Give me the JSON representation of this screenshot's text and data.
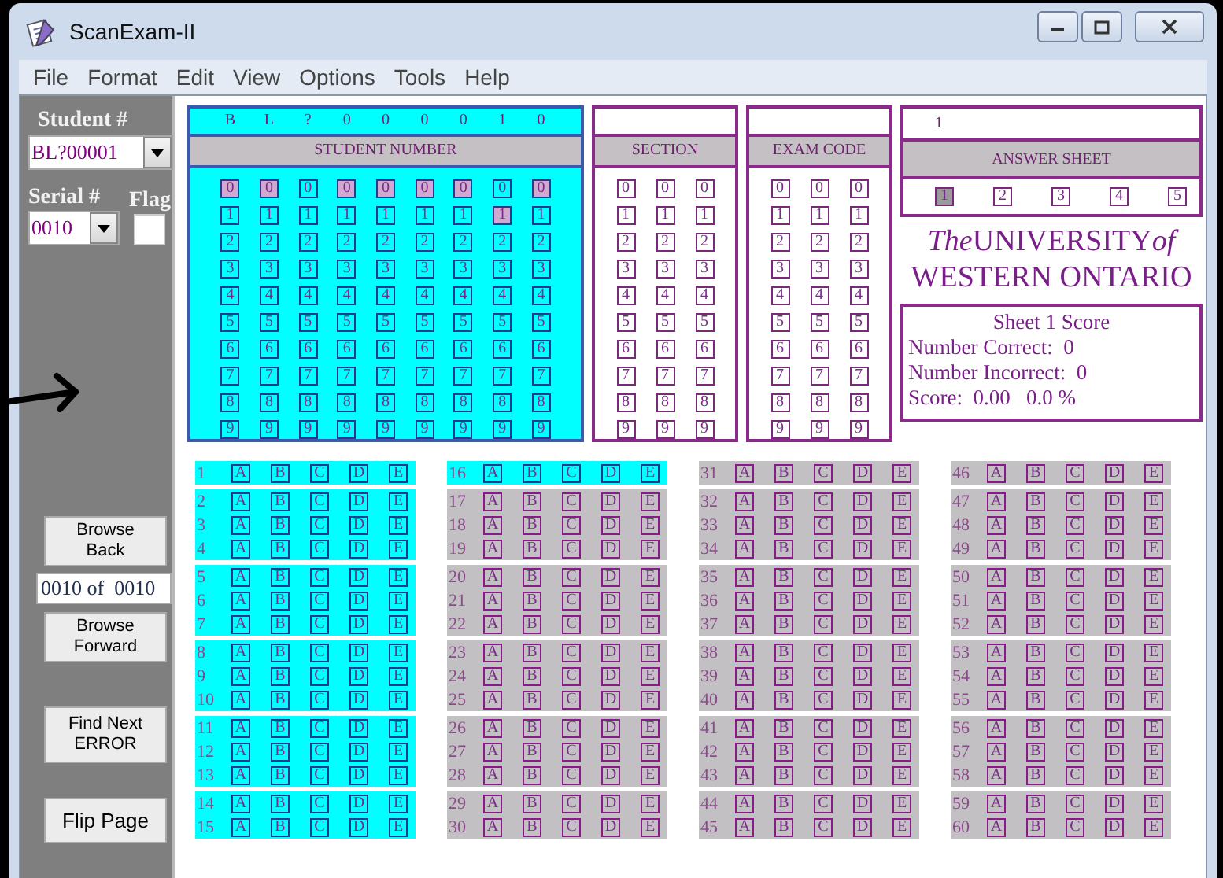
{
  "window": {
    "title": "ScanExam-II"
  },
  "menu": [
    "File",
    "Format",
    "Edit",
    "View",
    "Options",
    "Tools",
    "Help"
  ],
  "sidebar": {
    "student_label": "Student #",
    "student_value": "BL?00001",
    "serial_label": "Serial #",
    "serial_value": "0010",
    "flag_label": "Flag",
    "browse_back": "Browse\nBack",
    "position": "0010 of  0010",
    "browse_forward": "Browse\nForward",
    "find_next": "Find Next\nERROR",
    "flip_page": "Flip Page"
  },
  "student_number": {
    "entered": [
      "B",
      "L",
      "?",
      "0",
      "0",
      "0",
      "0",
      "1",
      "0"
    ],
    "title": "STUDENT NUMBER",
    "columns": [
      {
        "bubbles": [
          {
            "label": "0",
            "selected": true
          },
          {
            "label": "1",
            "selected": false
          },
          {
            "label": "2",
            "selected": false
          },
          {
            "label": "3",
            "selected": false
          },
          {
            "label": "4",
            "selected": false
          },
          {
            "label": "5",
            "selected": false
          },
          {
            "label": "6",
            "selected": false
          },
          {
            "label": "7",
            "selected": false
          },
          {
            "label": "8",
            "selected": false
          },
          {
            "label": "9",
            "selected": false
          }
        ]
      },
      {
        "bubbles": [
          {
            "label": "0",
            "selected": true
          },
          {
            "label": "1",
            "selected": false
          },
          {
            "label": "2",
            "selected": false
          },
          {
            "label": "3",
            "selected": false
          },
          {
            "label": "4",
            "selected": false
          },
          {
            "label": "5",
            "selected": false
          },
          {
            "label": "6",
            "selected": false
          },
          {
            "label": "7",
            "selected": false
          },
          {
            "label": "8",
            "selected": false
          },
          {
            "label": "9",
            "selected": false
          }
        ]
      },
      {
        "bubbles": [
          {
            "label": "0",
            "selected": false
          },
          {
            "label": "1",
            "selected": false
          },
          {
            "label": "2",
            "selected": false
          },
          {
            "label": "3",
            "selected": false
          },
          {
            "label": "4",
            "selected": false
          },
          {
            "label": "5",
            "selected": false
          },
          {
            "label": "6",
            "selected": false
          },
          {
            "label": "7",
            "selected": false
          },
          {
            "label": "8",
            "selected": false
          },
          {
            "label": "9",
            "selected": false
          }
        ]
      },
      {
        "bubbles": [
          {
            "label": "0",
            "selected": true
          },
          {
            "label": "1",
            "selected": false
          },
          {
            "label": "2",
            "selected": false
          },
          {
            "label": "3",
            "selected": false
          },
          {
            "label": "4",
            "selected": false
          },
          {
            "label": "5",
            "selected": false
          },
          {
            "label": "6",
            "selected": false
          },
          {
            "label": "7",
            "selected": false
          },
          {
            "label": "8",
            "selected": false
          },
          {
            "label": "9",
            "selected": false
          }
        ]
      },
      {
        "bubbles": [
          {
            "label": "0",
            "selected": true
          },
          {
            "label": "1",
            "selected": false
          },
          {
            "label": "2",
            "selected": false
          },
          {
            "label": "3",
            "selected": false
          },
          {
            "label": "4",
            "selected": false
          },
          {
            "label": "5",
            "selected": false
          },
          {
            "label": "6",
            "selected": false
          },
          {
            "label": "7",
            "selected": false
          },
          {
            "label": "8",
            "selected": false
          },
          {
            "label": "9",
            "selected": false
          }
        ]
      },
      {
        "bubbles": [
          {
            "label": "0",
            "selected": true
          },
          {
            "label": "1",
            "selected": false
          },
          {
            "label": "2",
            "selected": false
          },
          {
            "label": "3",
            "selected": false
          },
          {
            "label": "4",
            "selected": false
          },
          {
            "label": "5",
            "selected": false
          },
          {
            "label": "6",
            "selected": false
          },
          {
            "label": "7",
            "selected": false
          },
          {
            "label": "8",
            "selected": false
          },
          {
            "label": "9",
            "selected": false
          }
        ]
      },
      {
        "bubbles": [
          {
            "label": "0",
            "selected": true
          },
          {
            "label": "1",
            "selected": false
          },
          {
            "label": "2",
            "selected": false
          },
          {
            "label": "3",
            "selected": false
          },
          {
            "label": "4",
            "selected": false
          },
          {
            "label": "5",
            "selected": false
          },
          {
            "label": "6",
            "selected": false
          },
          {
            "label": "7",
            "selected": false
          },
          {
            "label": "8",
            "selected": false
          },
          {
            "label": "9",
            "selected": false
          }
        ]
      },
      {
        "bubbles": [
          {
            "label": "0",
            "selected": false
          },
          {
            "label": "1",
            "selected": true
          },
          {
            "label": "2",
            "selected": false
          },
          {
            "label": "3",
            "selected": false
          },
          {
            "label": "4",
            "selected": false
          },
          {
            "label": "5",
            "selected": false
          },
          {
            "label": "6",
            "selected": false
          },
          {
            "label": "7",
            "selected": false
          },
          {
            "label": "8",
            "selected": false
          },
          {
            "label": "9",
            "selected": false
          }
        ]
      },
      {
        "bubbles": [
          {
            "label": "0",
            "selected": true
          },
          {
            "label": "1",
            "selected": false
          },
          {
            "label": "2",
            "selected": false
          },
          {
            "label": "3",
            "selected": false
          },
          {
            "label": "4",
            "selected": false
          },
          {
            "label": "5",
            "selected": false
          },
          {
            "label": "6",
            "selected": false
          },
          {
            "label": "7",
            "selected": false
          },
          {
            "label": "8",
            "selected": false
          },
          {
            "label": "9",
            "selected": false
          }
        ]
      }
    ]
  },
  "section": {
    "title": "SECTION",
    "columns": [
      {
        "bubbles": [
          {
            "label": "0",
            "selected": false
          },
          {
            "label": "1",
            "selected": false
          },
          {
            "label": "2",
            "selected": false
          },
          {
            "label": "3",
            "selected": false
          },
          {
            "label": "4",
            "selected": false
          },
          {
            "label": "5",
            "selected": false
          },
          {
            "label": "6",
            "selected": false
          },
          {
            "label": "7",
            "selected": false
          },
          {
            "label": "8",
            "selected": false
          },
          {
            "label": "9",
            "selected": false
          }
        ]
      },
      {
        "bubbles": [
          {
            "label": "0",
            "selected": false
          },
          {
            "label": "1",
            "selected": false
          },
          {
            "label": "2",
            "selected": false
          },
          {
            "label": "3",
            "selected": false
          },
          {
            "label": "4",
            "selected": false
          },
          {
            "label": "5",
            "selected": false
          },
          {
            "label": "6",
            "selected": false
          },
          {
            "label": "7",
            "selected": false
          },
          {
            "label": "8",
            "selected": false
          },
          {
            "label": "9",
            "selected": false
          }
        ]
      },
      {
        "bubbles": [
          {
            "label": "0",
            "selected": false
          },
          {
            "label": "1",
            "selected": false
          },
          {
            "label": "2",
            "selected": false
          },
          {
            "label": "3",
            "selected": false
          },
          {
            "label": "4",
            "selected": false
          },
          {
            "label": "5",
            "selected": false
          },
          {
            "label": "6",
            "selected": false
          },
          {
            "label": "7",
            "selected": false
          },
          {
            "label": "8",
            "selected": false
          },
          {
            "label": "9",
            "selected": false
          }
        ]
      }
    ]
  },
  "exam_code": {
    "title": "EXAM CODE",
    "columns": [
      {
        "bubbles": [
          {
            "label": "0",
            "selected": false
          },
          {
            "label": "1",
            "selected": false
          },
          {
            "label": "2",
            "selected": false
          },
          {
            "label": "3",
            "selected": false
          },
          {
            "label": "4",
            "selected": false
          },
          {
            "label": "5",
            "selected": false
          },
          {
            "label": "6",
            "selected": false
          },
          {
            "label": "7",
            "selected": false
          },
          {
            "label": "8",
            "selected": false
          },
          {
            "label": "9",
            "selected": false
          }
        ]
      },
      {
        "bubbles": [
          {
            "label": "0",
            "selected": false
          },
          {
            "label": "1",
            "selected": false
          },
          {
            "label": "2",
            "selected": false
          },
          {
            "label": "3",
            "selected": false
          },
          {
            "label": "4",
            "selected": false
          },
          {
            "label": "5",
            "selected": false
          },
          {
            "label": "6",
            "selected": false
          },
          {
            "label": "7",
            "selected": false
          },
          {
            "label": "8",
            "selected": false
          },
          {
            "label": "9",
            "selected": false
          }
        ]
      },
      {
        "bubbles": [
          {
            "label": "0",
            "selected": false
          },
          {
            "label": "1",
            "selected": false
          },
          {
            "label": "2",
            "selected": false
          },
          {
            "label": "3",
            "selected": false
          },
          {
            "label": "4",
            "selected": false
          },
          {
            "label": "5",
            "selected": false
          },
          {
            "label": "6",
            "selected": false
          },
          {
            "label": "7",
            "selected": false
          },
          {
            "label": "8",
            "selected": false
          },
          {
            "label": "9",
            "selected": false
          }
        ]
      }
    ]
  },
  "answer_sheet": {
    "entered": "1",
    "title": "ANSWER SHEET",
    "bubbles": [
      {
        "label": "1",
        "selected": true
      },
      {
        "label": "2",
        "selected": false
      },
      {
        "label": "3",
        "selected": false
      },
      {
        "label": "4",
        "selected": false
      },
      {
        "label": "5",
        "selected": false
      }
    ]
  },
  "logo": {
    "first_line": [
      {
        "text": "The",
        "italic": true
      },
      {
        "text": "UNIVERSITY",
        "italic": false
      },
      {
        "text": "of",
        "italic": true
      }
    ],
    "second_line": "WESTERN ONTARIO"
  },
  "score": {
    "title": "Sheet 1 Score",
    "lines": [
      "Number Correct:  0",
      "Number Incorrect:  0",
      "Score:  0.00   0.0 %"
    ]
  },
  "answers": {
    "columns": [
      {
        "rows": [
          {
            "number": "1",
            "highlighted": true,
            "choices": [
              "A",
              "B",
              "C",
              "D",
              "E"
            ]
          },
          {
            "number": "2",
            "highlighted": true,
            "choices": [
              "A",
              "B",
              "C",
              "D",
              "E"
            ]
          },
          {
            "number": "3",
            "highlighted": true,
            "choices": [
              "A",
              "B",
              "C",
              "D",
              "E"
            ]
          },
          {
            "number": "4",
            "highlighted": true,
            "choices": [
              "A",
              "B",
              "C",
              "D",
              "E"
            ]
          },
          {
            "number": "5",
            "highlighted": true,
            "choices": [
              "A",
              "B",
              "C",
              "D",
              "E"
            ]
          },
          {
            "number": "6",
            "highlighted": true,
            "choices": [
              "A",
              "B",
              "C",
              "D",
              "E"
            ]
          },
          {
            "number": "7",
            "highlighted": true,
            "choices": [
              "A",
              "B",
              "C",
              "D",
              "E"
            ]
          },
          {
            "number": "8",
            "highlighted": true,
            "choices": [
              "A",
              "B",
              "C",
              "D",
              "E"
            ]
          },
          {
            "number": "9",
            "highlighted": true,
            "choices": [
              "A",
              "B",
              "C",
              "D",
              "E"
            ]
          },
          {
            "number": "10",
            "highlighted": true,
            "choices": [
              "A",
              "B",
              "C",
              "D",
              "E"
            ]
          },
          {
            "number": "11",
            "highlighted": true,
            "choices": [
              "A",
              "B",
              "C",
              "D",
              "E"
            ]
          },
          {
            "number": "12",
            "highlighted": true,
            "choices": [
              "A",
              "B",
              "C",
              "D",
              "E"
            ]
          },
          {
            "number": "13",
            "highlighted": true,
            "choices": [
              "A",
              "B",
              "C",
              "D",
              "E"
            ]
          },
          {
            "number": "14",
            "highlighted": true,
            "choices": [
              "A",
              "B",
              "C",
              "D",
              "E"
            ]
          },
          {
            "number": "15",
            "highlighted": true,
            "choices": [
              "A",
              "B",
              "C",
              "D",
              "E"
            ]
          }
        ]
      },
      {
        "rows": [
          {
            "number": "16",
            "highlighted": true,
            "choices": [
              "A",
              "B",
              "C",
              "D",
              "E"
            ]
          },
          {
            "number": "17",
            "highlighted": false,
            "choices": [
              "A",
              "B",
              "C",
              "D",
              "E"
            ]
          },
          {
            "number": "18",
            "highlighted": false,
            "choices": [
              "A",
              "B",
              "C",
              "D",
              "E"
            ]
          },
          {
            "number": "19",
            "highlighted": false,
            "choices": [
              "A",
              "B",
              "C",
              "D",
              "E"
            ]
          },
          {
            "number": "20",
            "highlighted": false,
            "choices": [
              "A",
              "B",
              "C",
              "D",
              "E"
            ]
          },
          {
            "number": "21",
            "highlighted": false,
            "choices": [
              "A",
              "B",
              "C",
              "D",
              "E"
            ]
          },
          {
            "number": "22",
            "highlighted": false,
            "choices": [
              "A",
              "B",
              "C",
              "D",
              "E"
            ]
          },
          {
            "number": "23",
            "highlighted": false,
            "choices": [
              "A",
              "B",
              "C",
              "D",
              "E"
            ]
          },
          {
            "number": "24",
            "highlighted": false,
            "choices": [
              "A",
              "B",
              "C",
              "D",
              "E"
            ]
          },
          {
            "number": "25",
            "highlighted": false,
            "choices": [
              "A",
              "B",
              "C",
              "D",
              "E"
            ]
          },
          {
            "number": "26",
            "highlighted": false,
            "choices": [
              "A",
              "B",
              "C",
              "D",
              "E"
            ]
          },
          {
            "number": "27",
            "highlighted": false,
            "choices": [
              "A",
              "B",
              "C",
              "D",
              "E"
            ]
          },
          {
            "number": "28",
            "highlighted": false,
            "choices": [
              "A",
              "B",
              "C",
              "D",
              "E"
            ]
          },
          {
            "number": "29",
            "highlighted": false,
            "choices": [
              "A",
              "B",
              "C",
              "D",
              "E"
            ]
          },
          {
            "number": "30",
            "highlighted": false,
            "choices": [
              "A",
              "B",
              "C",
              "D",
              "E"
            ]
          }
        ]
      },
      {
        "rows": [
          {
            "number": "31",
            "highlighted": false,
            "choices": [
              "A",
              "B",
              "C",
              "D",
              "E"
            ]
          },
          {
            "number": "32",
            "highlighted": false,
            "choices": [
              "A",
              "B",
              "C",
              "D",
              "E"
            ]
          },
          {
            "number": "33",
            "highlighted": false,
            "choices": [
              "A",
              "B",
              "C",
              "D",
              "E"
            ]
          },
          {
            "number": "34",
            "highlighted": false,
            "choices": [
              "A",
              "B",
              "C",
              "D",
              "E"
            ]
          },
          {
            "number": "35",
            "highlighted": false,
            "choices": [
              "A",
              "B",
              "C",
              "D",
              "E"
            ]
          },
          {
            "number": "36",
            "highlighted": false,
            "choices": [
              "A",
              "B",
              "C",
              "D",
              "E"
            ]
          },
          {
            "number": "37",
            "highlighted": false,
            "choices": [
              "A",
              "B",
              "C",
              "D",
              "E"
            ]
          },
          {
            "number": "38",
            "highlighted": false,
            "choices": [
              "A",
              "B",
              "C",
              "D",
              "E"
            ]
          },
          {
            "number": "39",
            "highlighted": false,
            "choices": [
              "A",
              "B",
              "C",
              "D",
              "E"
            ]
          },
          {
            "number": "40",
            "highlighted": false,
            "choices": [
              "A",
              "B",
              "C",
              "D",
              "E"
            ]
          },
          {
            "number": "41",
            "highlighted": false,
            "choices": [
              "A",
              "B",
              "C",
              "D",
              "E"
            ]
          },
          {
            "number": "42",
            "highlighted": false,
            "choices": [
              "A",
              "B",
              "C",
              "D",
              "E"
            ]
          },
          {
            "number": "43",
            "highlighted": false,
            "choices": [
              "A",
              "B",
              "C",
              "D",
              "E"
            ]
          },
          {
            "number": "44",
            "highlighted": false,
            "choices": [
              "A",
              "B",
              "C",
              "D",
              "E"
            ]
          },
          {
            "number": "45",
            "highlighted": false,
            "choices": [
              "A",
              "B",
              "C",
              "D",
              "E"
            ]
          }
        ]
      },
      {
        "rows": [
          {
            "number": "46",
            "highlighted": false,
            "choices": [
              "A",
              "B",
              "C",
              "D",
              "E"
            ]
          },
          {
            "number": "47",
            "highlighted": false,
            "choices": [
              "A",
              "B",
              "C",
              "D",
              "E"
            ]
          },
          {
            "number": "48",
            "highlighted": false,
            "choices": [
              "A",
              "B",
              "C",
              "D",
              "E"
            ]
          },
          {
            "number": "49",
            "highlighted": false,
            "choices": [
              "A",
              "B",
              "C",
              "D",
              "E"
            ]
          },
          {
            "number": "50",
            "highlighted": false,
            "choices": [
              "A",
              "B",
              "C",
              "D",
              "E"
            ]
          },
          {
            "number": "51",
            "highlighted": false,
            "choices": [
              "A",
              "B",
              "C",
              "D",
              "E"
            ]
          },
          {
            "number": "52",
            "highlighted": false,
            "choices": [
              "A",
              "B",
              "C",
              "D",
              "E"
            ]
          },
          {
            "number": "53",
            "highlighted": false,
            "choices": [
              "A",
              "B",
              "C",
              "D",
              "E"
            ]
          },
          {
            "number": "54",
            "highlighted": false,
            "choices": [
              "A",
              "B",
              "C",
              "D",
              "E"
            ]
          },
          {
            "number": "55",
            "highlighted": false,
            "choices": [
              "A",
              "B",
              "C",
              "D",
              "E"
            ]
          },
          {
            "number": "56",
            "highlighted": false,
            "choices": [
              "A",
              "B",
              "C",
              "D",
              "E"
            ]
          },
          {
            "number": "57",
            "highlighted": false,
            "choices": [
              "A",
              "B",
              "C",
              "D",
              "E"
            ]
          },
          {
            "number": "58",
            "highlighted": false,
            "choices": [
              "A",
              "B",
              "C",
              "D",
              "E"
            ]
          },
          {
            "number": "59",
            "highlighted": false,
            "choices": [
              "A",
              "B",
              "C",
              "D",
              "E"
            ]
          },
          {
            "number": "60",
            "highlighted": false,
            "choices": [
              "A",
              "B",
              "C",
              "D",
              "E"
            ]
          }
        ]
      }
    ]
  }
}
